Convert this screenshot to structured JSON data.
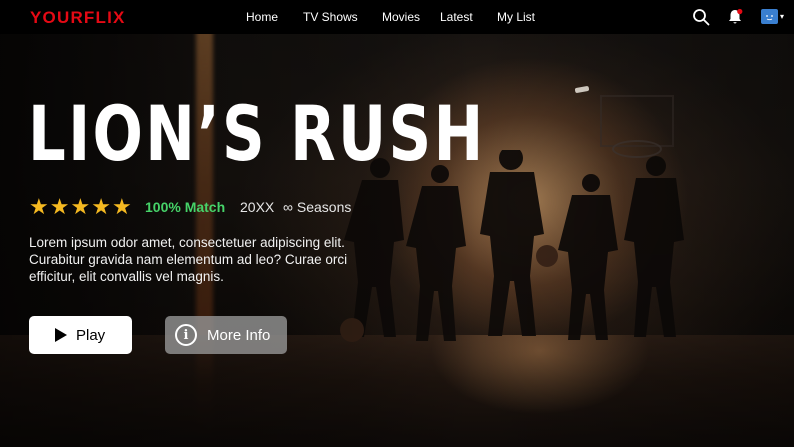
{
  "app": {
    "logo": "YOURFLIX"
  },
  "nav": {
    "items": [
      {
        "label": "Home"
      },
      {
        "label": "TV Shows"
      },
      {
        "label": "Movies"
      },
      {
        "label": "Latest"
      },
      {
        "label": "My List"
      }
    ]
  },
  "header_icons": {
    "search": "search-icon",
    "notifications": "bell-icon",
    "profile": "avatar",
    "profile_menu": "chevron-down-icon",
    "caret_glyph": "▾"
  },
  "hero": {
    "title": "LION’S RUSH",
    "rating": {
      "stars": 5,
      "max": 5,
      "star_glyph": "★"
    },
    "match": "100% Match",
    "year": "20XX",
    "seasons": "∞ Seasons",
    "description": "Lorem ipsum odor amet, consectetuer adipiscing elit. Curabitur gravida nam elementum ad leo? Curae orci efficitur, elit convallis vel magnis.",
    "buttons": {
      "play_label": "Play",
      "info_label": "More Info",
      "info_glyph": "i"
    }
  },
  "colors": {
    "brand": "#e50914",
    "match": "#46d369",
    "star": "#f5b921",
    "nav_background": "#000000"
  }
}
